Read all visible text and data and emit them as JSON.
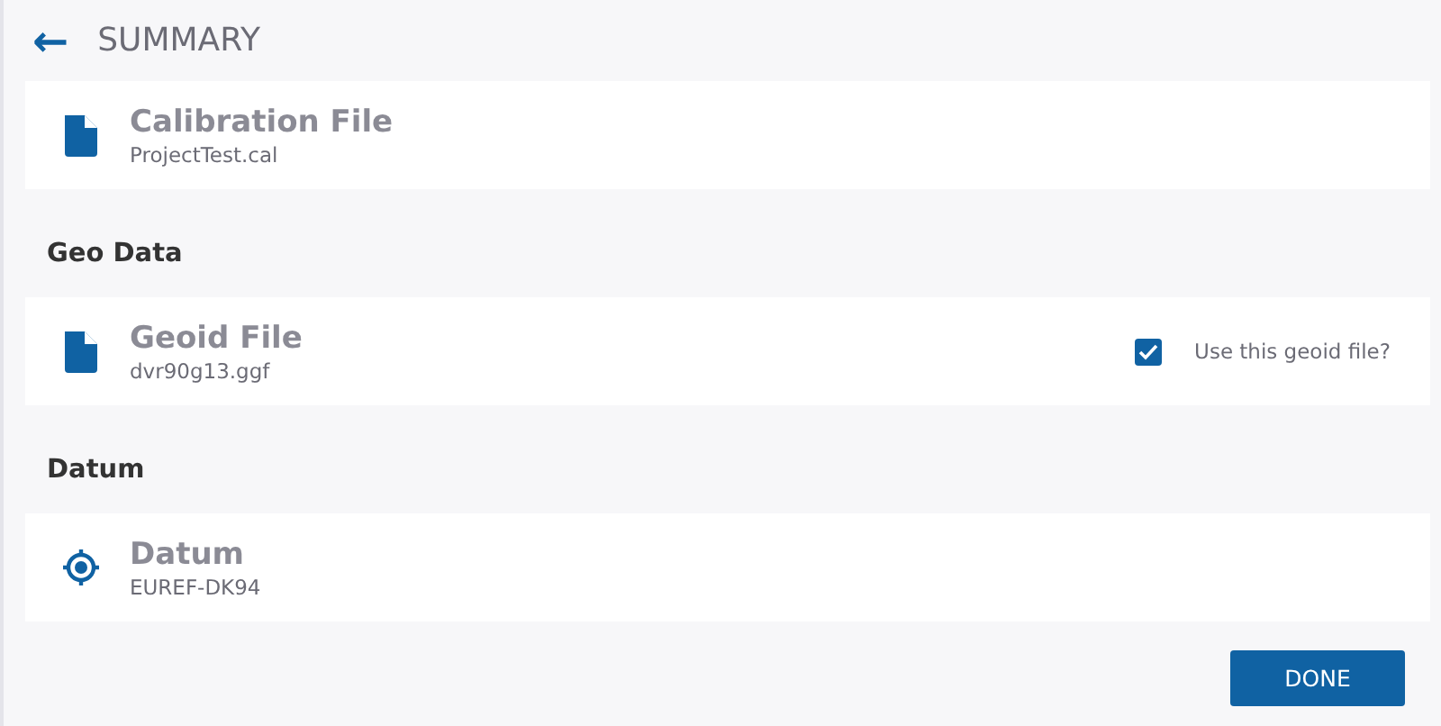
{
  "header": {
    "back": "←",
    "title": "SUMMARY"
  },
  "sections": [
    {
      "items": [
        {
          "kind": "file",
          "title": "Calibration File",
          "subtitle": "ProjectTest.cal"
        }
      ]
    },
    {
      "heading": "Geo Data",
      "items": [
        {
          "kind": "file",
          "title": "Geoid File",
          "subtitle": "dvr90g13.ggf",
          "option": {
            "label": "Use this geoid file?",
            "checked": true
          }
        }
      ]
    },
    {
      "heading": "Datum",
      "items": [
        {
          "kind": "datum",
          "title": "Datum",
          "subtitle": "EUREF-DK94"
        }
      ]
    }
  ],
  "done_button": "DONE"
}
